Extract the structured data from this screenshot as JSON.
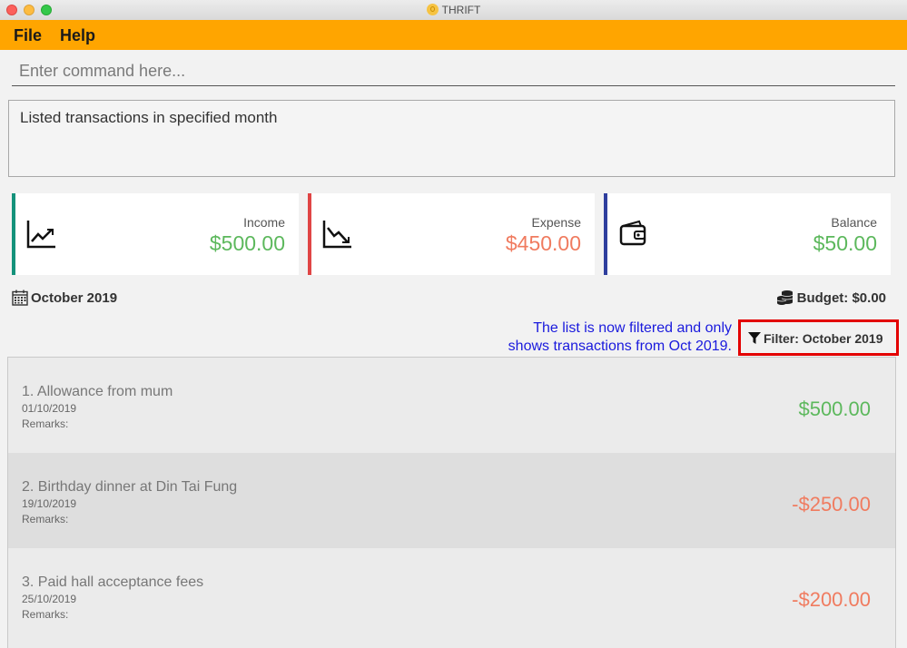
{
  "window": {
    "title": "THRIFT"
  },
  "menu": {
    "file": "File",
    "help": "Help"
  },
  "command": {
    "placeholder": "Enter command here...",
    "value": ""
  },
  "result": {
    "message": "Listed transactions in specified month"
  },
  "summary": {
    "income": {
      "label": "Income",
      "amount": "$500.00"
    },
    "expense": {
      "label": "Expense",
      "amount": "$450.00"
    },
    "balance": {
      "label": "Balance",
      "amount": "$50.00"
    }
  },
  "period": {
    "month": "October 2019",
    "budget": "Budget: $0.00"
  },
  "annotation": {
    "line1": "The list is now filtered and only",
    "line2": "shows transactions from Oct 2019."
  },
  "filter": {
    "label": "Filter: October 2019"
  },
  "transactions": [
    {
      "name": "1.  Allowance from mum",
      "date": "01/10/2019",
      "remarks": "Remarks:",
      "value": "$500.00"
    },
    {
      "name": "2.  Birthday dinner at Din Tai Fung",
      "date": "19/10/2019",
      "remarks": "Remarks:",
      "value": "-$250.00"
    },
    {
      "name": "3.  Paid hall acceptance fees",
      "date": "25/10/2019",
      "remarks": "Remarks:",
      "value": "-$200.00"
    }
  ],
  "colors": {
    "menubar": "#ffa500",
    "income": "#5cb85c",
    "expense": "#f07b5f",
    "annotation": "#1a1add",
    "highlight": "#e30000"
  }
}
